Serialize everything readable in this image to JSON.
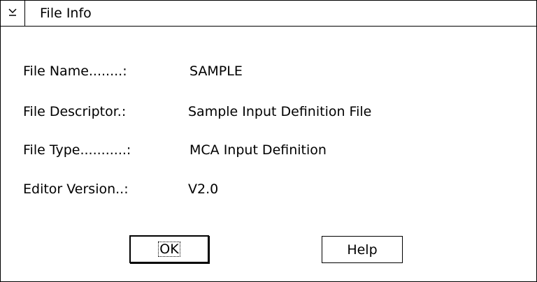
{
  "window": {
    "title": "File Info",
    "sysmenu_icon": "chevron-down-underline-icon"
  },
  "fields": [
    {
      "label": "File Name........:",
      "value": "SAMPLE"
    },
    {
      "label": "File Descriptor.:",
      "value": "Sample Input Definition File"
    },
    {
      "label": "File Type...........:",
      "value": "MCA Input Definition"
    },
    {
      "label": "Editor Version..:",
      "value": "V2.0"
    }
  ],
  "buttons": {
    "ok_label": "OK",
    "help_label": "Help"
  }
}
